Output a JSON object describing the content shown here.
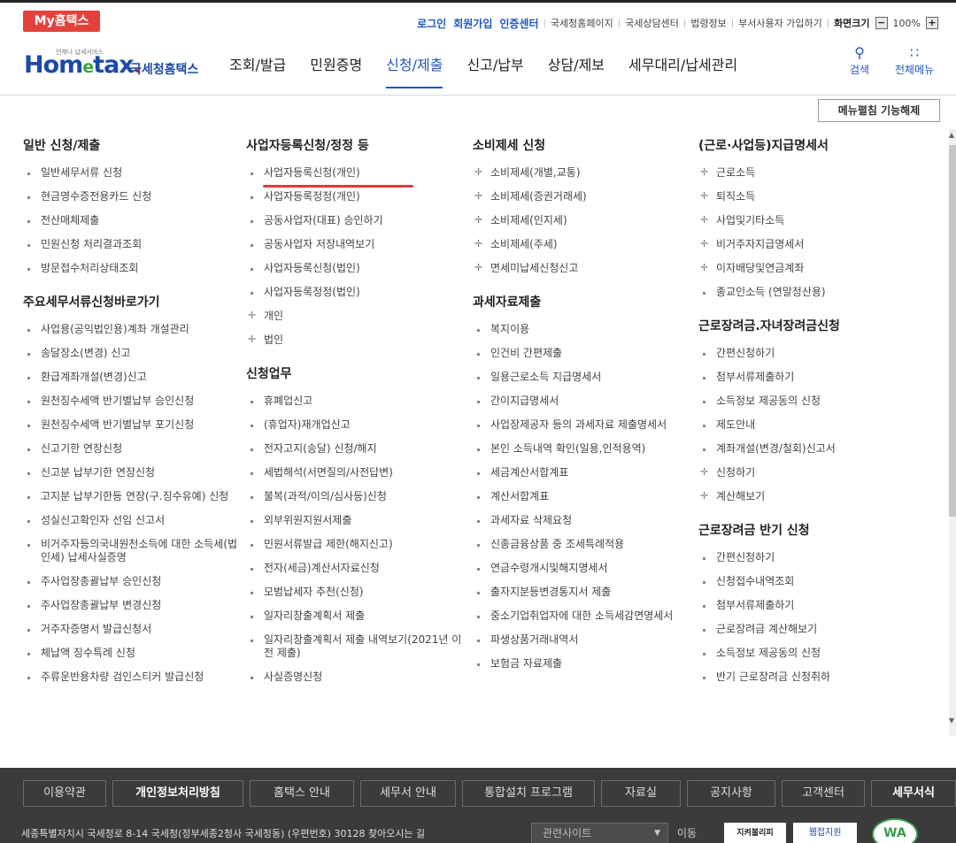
{
  "topbar": {
    "my_hometax": "My홈택스",
    "links": [
      {
        "label": "로그인",
        "style": "blue"
      },
      {
        "label": "회원가입",
        "style": "blue"
      },
      {
        "label": "인증센터",
        "style": "blue"
      },
      {
        "label": "국세청홈페이지",
        "style": "normal"
      },
      {
        "label": "국세상담센터",
        "style": "normal"
      },
      {
        "label": "법령정보",
        "style": "normal"
      },
      {
        "label": "부서사용자 가입하기",
        "style": "normal"
      }
    ],
    "zoom_label": "화면크기",
    "zoom_minus": "−",
    "zoom_value": "100%",
    "zoom_plus": "+"
  },
  "header": {
    "logo_small": "언제나 납세서비스",
    "logo_home": "Hom",
    "logo_e": "e",
    "logo_tax": "tax",
    "logo_dot": ".",
    "logo_name": "국세청홈택스",
    "gnb": [
      "조회/발급",
      "민원증명",
      "신청/제출",
      "신고/납부",
      "상담/제보",
      "세무대리/납세관리"
    ],
    "active_gnb_index": 2,
    "search_label": "검색",
    "menu_label": "전체메뉴"
  },
  "release_button": "메뉴펼침 기능해제",
  "columns": {
    "col1": {
      "title1": "일반 신청/제출",
      "items1": [
        "일반세무서류 신청",
        "현금영수증전용카드 신청",
        "전산매체제출",
        "민원신청 처리결과조회",
        "방문접수처리상태조회"
      ],
      "title2": "주요세무서류신청바로가기",
      "items2": [
        "사업용(공익법인용)계좌 개설관리",
        "송달장소(변경) 신고",
        "환급계좌개설(변경)신고",
        "원천징수세액 반기별납부 승인신청",
        "원천징수세액 반기별납부 포기신청",
        "신고기한 연장신청",
        "신고분 납부기한 연장신청",
        "고지분 납부기한등 연장(구.징수유예) 신청",
        "성실신고확인자 선임 신고서",
        "비거주자등의국내원천소득에 대한 소득세(법인세) 납세사실증명",
        "주사업장총괄납부 승인신청",
        "주사업장총괄납부 변경신청",
        "거주자증명서 발급신청서",
        "체납액 징수특례 신청",
        "주류운반용차량 검인스티커 발급신청"
      ]
    },
    "col2": {
      "title1": "사업자등록신청/정정 등",
      "items1": [
        {
          "label": "사업자등록신청(개인)",
          "marker": "b"
        },
        {
          "label": "사업자등록정정(개인)",
          "marker": "b"
        },
        {
          "label": "공동사업자(대표) 승인하기",
          "marker": "b"
        },
        {
          "label": "공동사업자 저장내역보기",
          "marker": "b"
        },
        {
          "label": "사업자등록신청(법인)",
          "marker": "b"
        },
        {
          "label": "사업자등록정정(법인)",
          "marker": "b"
        },
        {
          "label": "개인",
          "marker": "p"
        },
        {
          "label": "법인",
          "marker": "p"
        }
      ],
      "title2": "신청업무",
      "items2": [
        "휴폐업신고",
        "(휴업자)재개업신고",
        "전자고지(송달) 신청/해지",
        "세법해석(서면질의/사전답변)",
        "불복(과적/이의/심사등)신청",
        "외부위원지원서제출",
        "민원서류발급 제한(해지신고)",
        "전자(세금)계산서자료신청",
        "모범납세자 추천(신청)",
        "일자리창출계획서 제출",
        "일자리창출계획서 제출 내역보기(2021년 이전 제출)",
        "사실증명신청"
      ]
    },
    "col3": {
      "title1": "소비제세 신청",
      "items1": [
        "소비제세(개별,교통)",
        "소비제세(증권거래세)",
        "소비제세(인지세)",
        "소비제세(주세)",
        "면세미납세신청신고"
      ],
      "title2": "과세자료제출",
      "items2": [
        "복지이용",
        "인건비 간편제출",
        "일용근로소득 지급명세서",
        "간이지급명세서",
        "사업장제공자 등의 과세자료 제출명세서",
        "본인 소득내역 확인(일용,인적용역)",
        "세금계산서합계표",
        "계산서합계표",
        "과세자료 삭제요청",
        "신종금융상품 중 조세특례적용",
        "연금수령개시및해지명세서",
        "출자지분등변경통지서 제출",
        "중소기업취업자에 대한 소득세감면명세서",
        "파생상품거래내역서",
        "보험금 자료제출"
      ]
    },
    "col4": {
      "title1": "(근로·사업등)지급명세서",
      "items1": [
        {
          "label": "근로소득",
          "marker": "p"
        },
        {
          "label": "퇴직소득",
          "marker": "p"
        },
        {
          "label": "사업및기타소득",
          "marker": "p"
        },
        {
          "label": "비거주자지급명세서",
          "marker": "p"
        },
        {
          "label": "이자배당및연금계좌",
          "marker": "p"
        },
        {
          "label": "종교인소득 (연말정산용)",
          "marker": "b"
        }
      ],
      "title2": "근로장려금.자녀장려금신청",
      "items2": [
        {
          "label": "간편신청하기",
          "marker": "b"
        },
        {
          "label": "첨부서류제출하기",
          "marker": "b"
        },
        {
          "label": "소득정보 제공동의 신청",
          "marker": "b"
        },
        {
          "label": "제도안내",
          "marker": "b"
        },
        {
          "label": "계좌개설(변경/철회)신고서",
          "marker": "b"
        },
        {
          "label": "신청하기",
          "marker": "p"
        },
        {
          "label": "계산해보기",
          "marker": "p"
        }
      ],
      "title3": "근로장려금 반기 신청",
      "items3": [
        "간편신청하기",
        "신청접수내역조회",
        "첨부서류제출하기",
        "근로장려금 계산해보기",
        "소득정보 제공동의 신청",
        "반기 근로장려금 신청취하"
      ]
    }
  },
  "footer": {
    "nav": [
      {
        "label": "이용약관",
        "bold": false,
        "w": 94
      },
      {
        "label": "개인정보처리방침",
        "bold": true,
        "w": 148
      },
      {
        "label": "홈택스 안내",
        "bold": false,
        "w": 118
      },
      {
        "label": "세무서 안내",
        "bold": false,
        "w": 108
      },
      {
        "label": "통합설치 프로그램",
        "bold": false,
        "w": 150
      },
      {
        "label": "자료실",
        "bold": false,
        "w": 90
      },
      {
        "label": "공지사항",
        "bold": false,
        "w": 100
      },
      {
        "label": "고객센터",
        "bold": false,
        "w": 94
      },
      {
        "label": "세무서식",
        "bold": true,
        "w": 96
      }
    ],
    "address": "세종특별자치시 국세청로 8-14 국세청(정부세종2청사 국세청동) (우편번호) 30128  찾아오시는 길",
    "related_select": "관련사이트",
    "go_label": "이동",
    "badge1": "지켜볼리피",
    "badge2": "웹접지원",
    "wa_mark": "WA"
  },
  "colors": {
    "accent_blue": "#1f56c1",
    "brand_red": "#e4413d",
    "footer_bg": "#3b3b3b"
  }
}
